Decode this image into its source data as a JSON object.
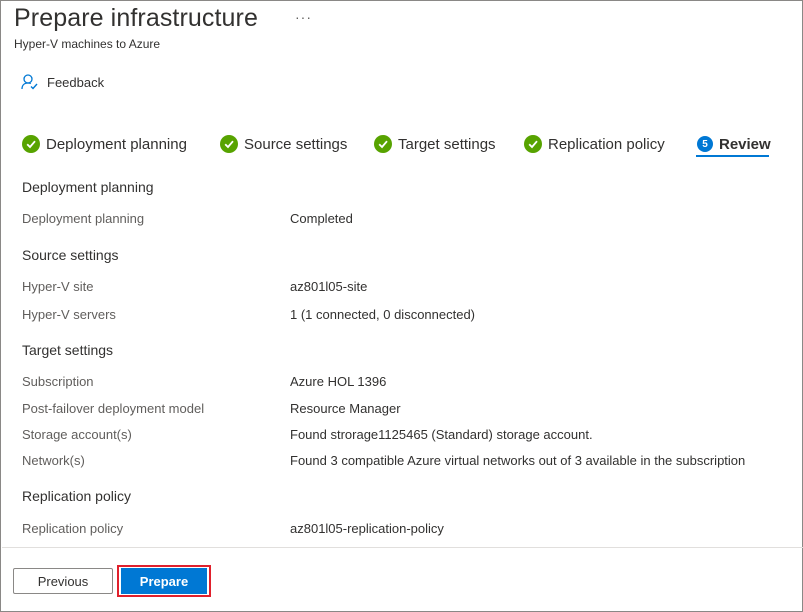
{
  "header": {
    "title": "Prepare infrastructure",
    "ellipsis": "···",
    "subtitle": "Hyper-V machines to Azure"
  },
  "toolbar": {
    "feedback_label": "Feedback",
    "feedback_icon": "feedback-icon"
  },
  "tabs": [
    {
      "label": "Deployment planning",
      "state": "completed"
    },
    {
      "label": "Source settings",
      "state": "completed"
    },
    {
      "label": "Target settings",
      "state": "completed"
    },
    {
      "label": "Replication policy",
      "state": "completed"
    },
    {
      "label": "Review",
      "state": "active",
      "number": "5"
    }
  ],
  "review": {
    "deployment_planning": {
      "heading": "Deployment planning",
      "rows": [
        {
          "label": "Deployment planning",
          "value": "Completed"
        }
      ]
    },
    "source_settings": {
      "heading": "Source settings",
      "rows": [
        {
          "label": "Hyper-V site",
          "value": "az801l05-site"
        },
        {
          "label": "Hyper-V servers",
          "value": "1 (1 connected, 0 disconnected)"
        }
      ]
    },
    "target_settings": {
      "heading": "Target settings",
      "rows": [
        {
          "label": "Subscription",
          "value": "Azure HOL 1396"
        },
        {
          "label": "Post-failover deployment model",
          "value": "Resource Manager"
        },
        {
          "label": "Storage account(s)",
          "value": "Found strorage1125465 (Standard) storage account."
        },
        {
          "label": "Network(s)",
          "value": "Found 3 compatible Azure virtual networks out of 3 available in the subscription"
        }
      ]
    },
    "replication_policy": {
      "heading": "Replication policy",
      "rows": [
        {
          "label": "Replication policy",
          "value": "az801l05-replication-policy"
        }
      ]
    }
  },
  "footer": {
    "previous_label": "Previous",
    "prepare_label": "Prepare"
  },
  "colors": {
    "accent": "#0078d4",
    "success": "#57a300",
    "highlight": "#e0202c"
  }
}
